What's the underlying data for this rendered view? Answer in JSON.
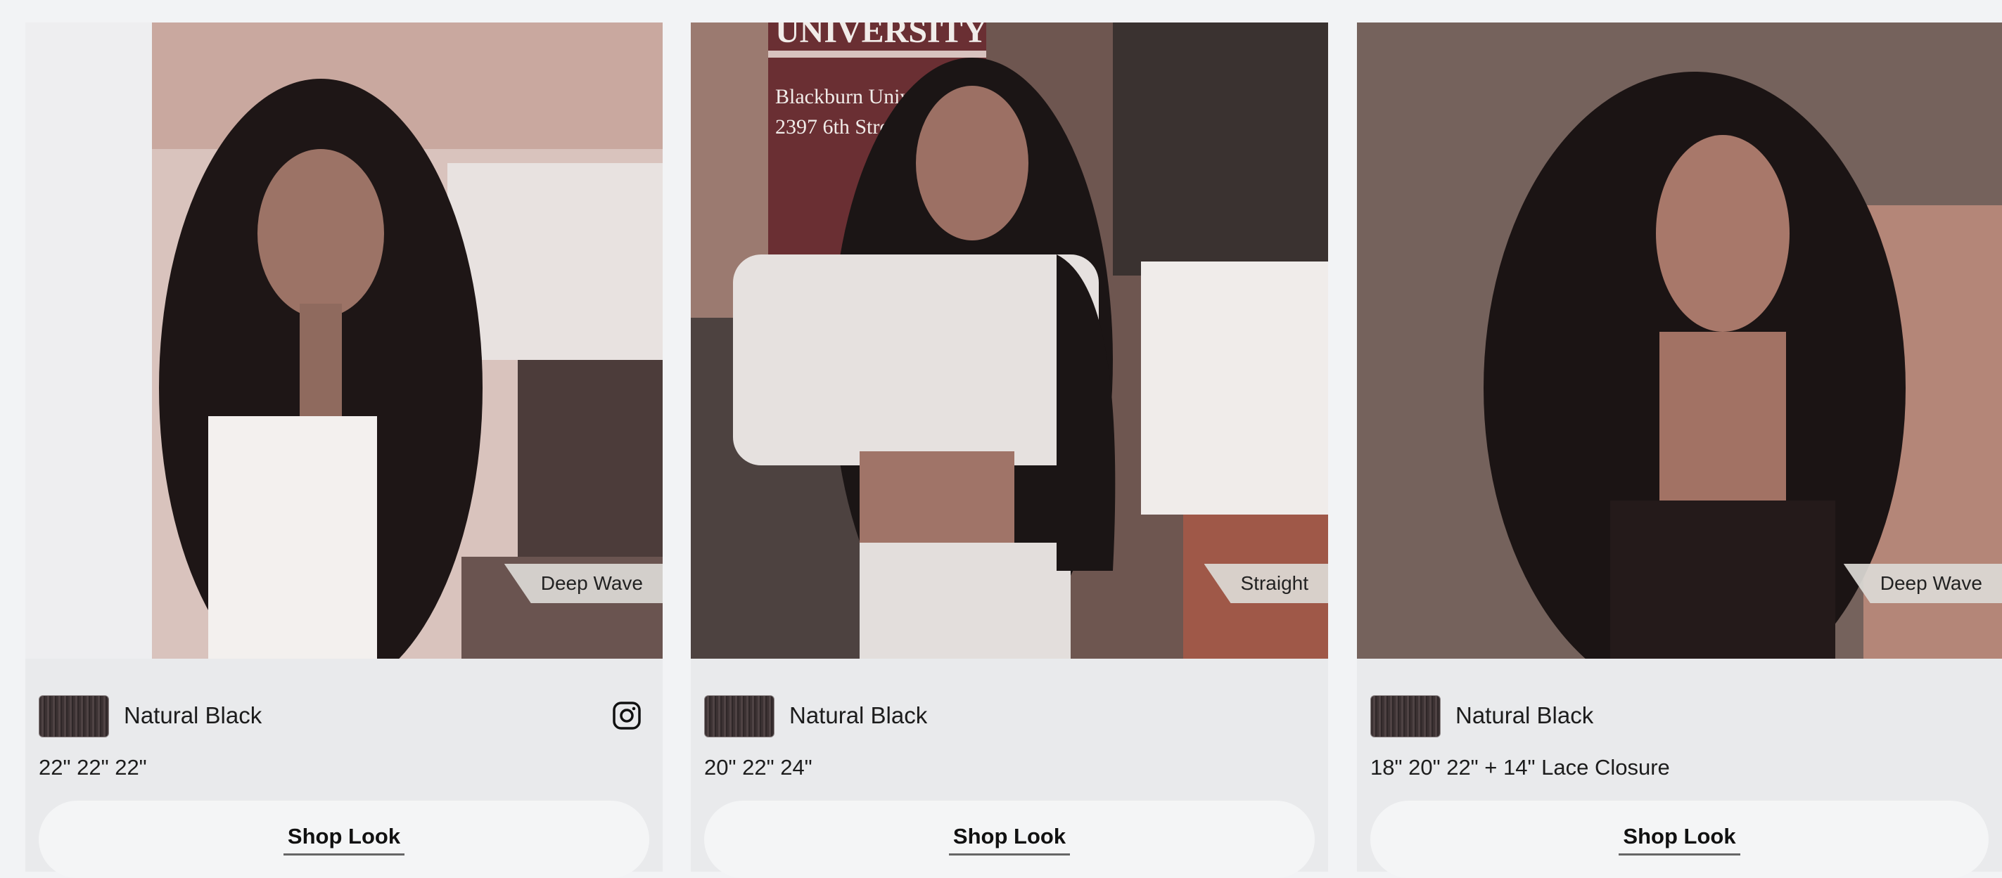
{
  "looks": [
    {
      "texture": "Deep Wave",
      "color_name": "Natural Black",
      "lengths": "22\" 22\" 22\"",
      "shop_label": "Shop Look",
      "has_instagram": true
    },
    {
      "texture": "Straight",
      "color_name": "Natural Black",
      "lengths": "20\" 22\" 24\"",
      "shop_label": "Shop Look",
      "has_instagram": false
    },
    {
      "texture": "Deep Wave",
      "color_name": "Natural Black",
      "lengths": "18\" 20\" 22\" + 14\" Lace Closure",
      "shop_label": "Shop Look",
      "has_instagram": false
    }
  ],
  "sign": {
    "line1": "UNIVERSITY",
    "line2": "Blackburn University C",
    "line3": "2397 6th Street"
  },
  "colors": {
    "page_bg": "#f2f3f5",
    "card_bg": "#e9eaec",
    "button_bg": "#f4f5f6",
    "swatch": "#3c3233"
  },
  "icons": {
    "instagram": "instagram-icon"
  }
}
